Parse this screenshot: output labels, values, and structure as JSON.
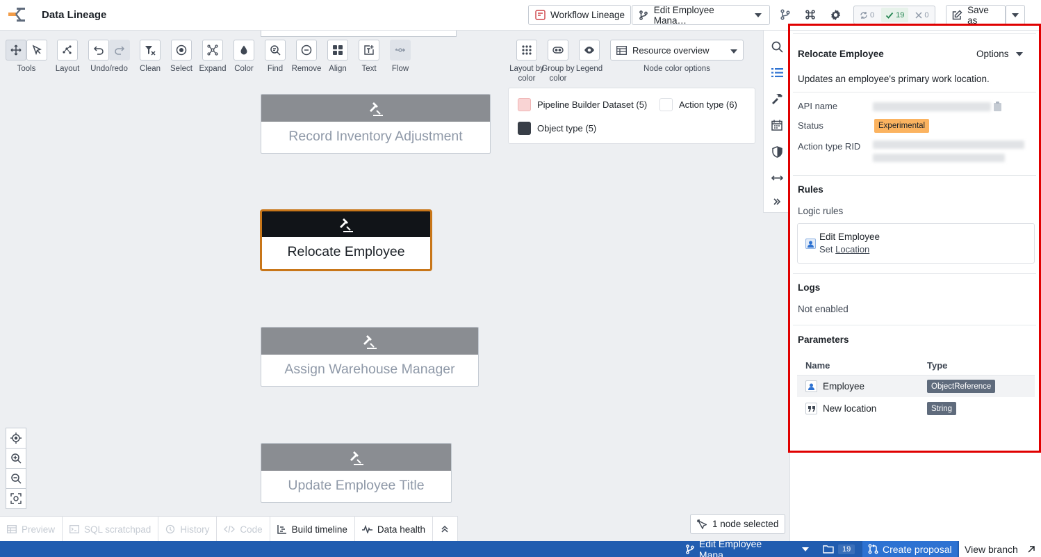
{
  "header": {
    "app_title": "Data Lineage",
    "workflow_btn": "Workflow Lineage",
    "branch_btn": "Edit Employee Mana…",
    "status": {
      "sync": "0",
      "ok": "19",
      "error": "0"
    },
    "save_btn": "Save as"
  },
  "toolbar": {
    "tools": "Tools",
    "layout": "Layout",
    "undo_redo": "Undo/redo",
    "clean": "Clean",
    "select": "Select",
    "expand": "Expand",
    "color": "Color",
    "find": "Find",
    "remove": "Remove",
    "align": "Align",
    "text": "Text",
    "flow": "Flow",
    "layout_by_color": "Layout by color",
    "group_by_color": "Group by color",
    "legend": "Legend",
    "resource_select": "Resource overview",
    "node_color_options": "Node color options"
  },
  "legend": {
    "items": [
      {
        "label": "Pipeline Builder Dataset (5)",
        "color": "#f9d4d4"
      },
      {
        "label": "Action type (6)",
        "color": "#ffffff"
      },
      {
        "label": "Object type (5)",
        "color": "#383e47"
      }
    ]
  },
  "nodes": [
    {
      "label": "Record Inventory Adjustment"
    },
    {
      "label": "Relocate Employee"
    },
    {
      "label": "Assign Warehouse Manager"
    },
    {
      "label": "Update Employee Title"
    }
  ],
  "bottom_tabs": {
    "preview": "Preview",
    "sql": "SQL scratchpad",
    "history": "History",
    "code": "Code",
    "build_timeline": "Build timeline",
    "data_health": "Data health"
  },
  "selection": {
    "label": "1 node selected"
  },
  "footer": {
    "branch": "Edit Employee Mana…",
    "count": "19",
    "create_proposal": "Create proposal",
    "view_branch": "View branch"
  },
  "panel": {
    "title": "Relocate Employee",
    "options": "Options",
    "description": "Updates an employee's primary work location.",
    "api_name_label": "API name",
    "status_label": "Status",
    "status_value": "Experimental",
    "rid_label": "Action type RID",
    "rules_title": "Rules",
    "logic_rules": "Logic rules",
    "rule": {
      "title": "Edit Employee",
      "set_prefix": "Set",
      "set_target": "Location"
    },
    "logs_title": "Logs",
    "logs_value": "Not enabled",
    "params_title": "Parameters",
    "params_col_name": "Name",
    "params_col_type": "Type",
    "params": [
      {
        "name": "Employee",
        "type": "ObjectReference"
      },
      {
        "name": "New location",
        "type": "String"
      }
    ]
  },
  "colors": {
    "accent": "#2d72d2",
    "selected_border": "#c87619",
    "experimental": "#fbb360",
    "footer": "#215db0"
  }
}
